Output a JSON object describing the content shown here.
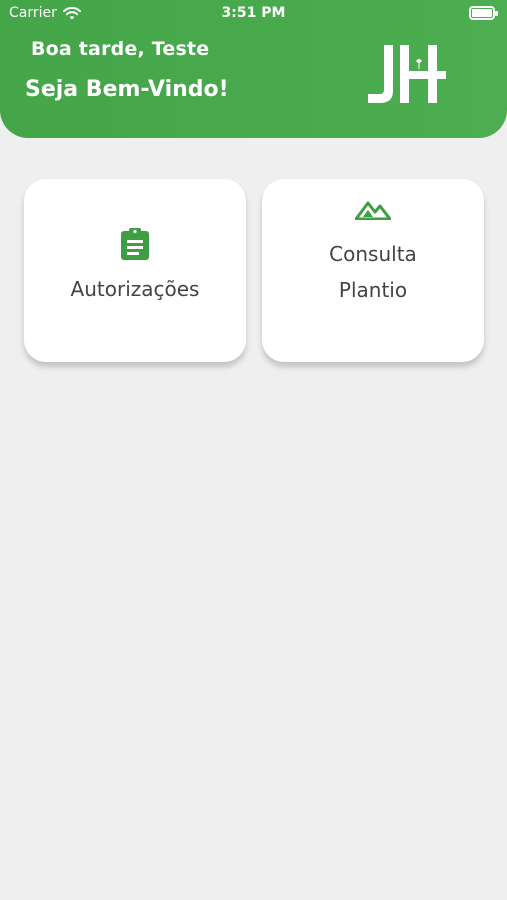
{
  "status_bar": {
    "carrier": "Carrier",
    "time": "3:51 PM"
  },
  "header": {
    "greeting": "Boa tarde, Teste",
    "welcome": "Seja Bem-Vindo!",
    "logo": "JH"
  },
  "colors": {
    "primary": "#4cae50",
    "card": "#ffffff",
    "background": "#efefef",
    "text": "#444444"
  },
  "menu": {
    "items": [
      {
        "icon": "clipboard-icon",
        "label": "Autorizações"
      },
      {
        "icon": "mountain-icon",
        "label_line1": "Consulta",
        "label_line2": "Plantio"
      }
    ]
  }
}
